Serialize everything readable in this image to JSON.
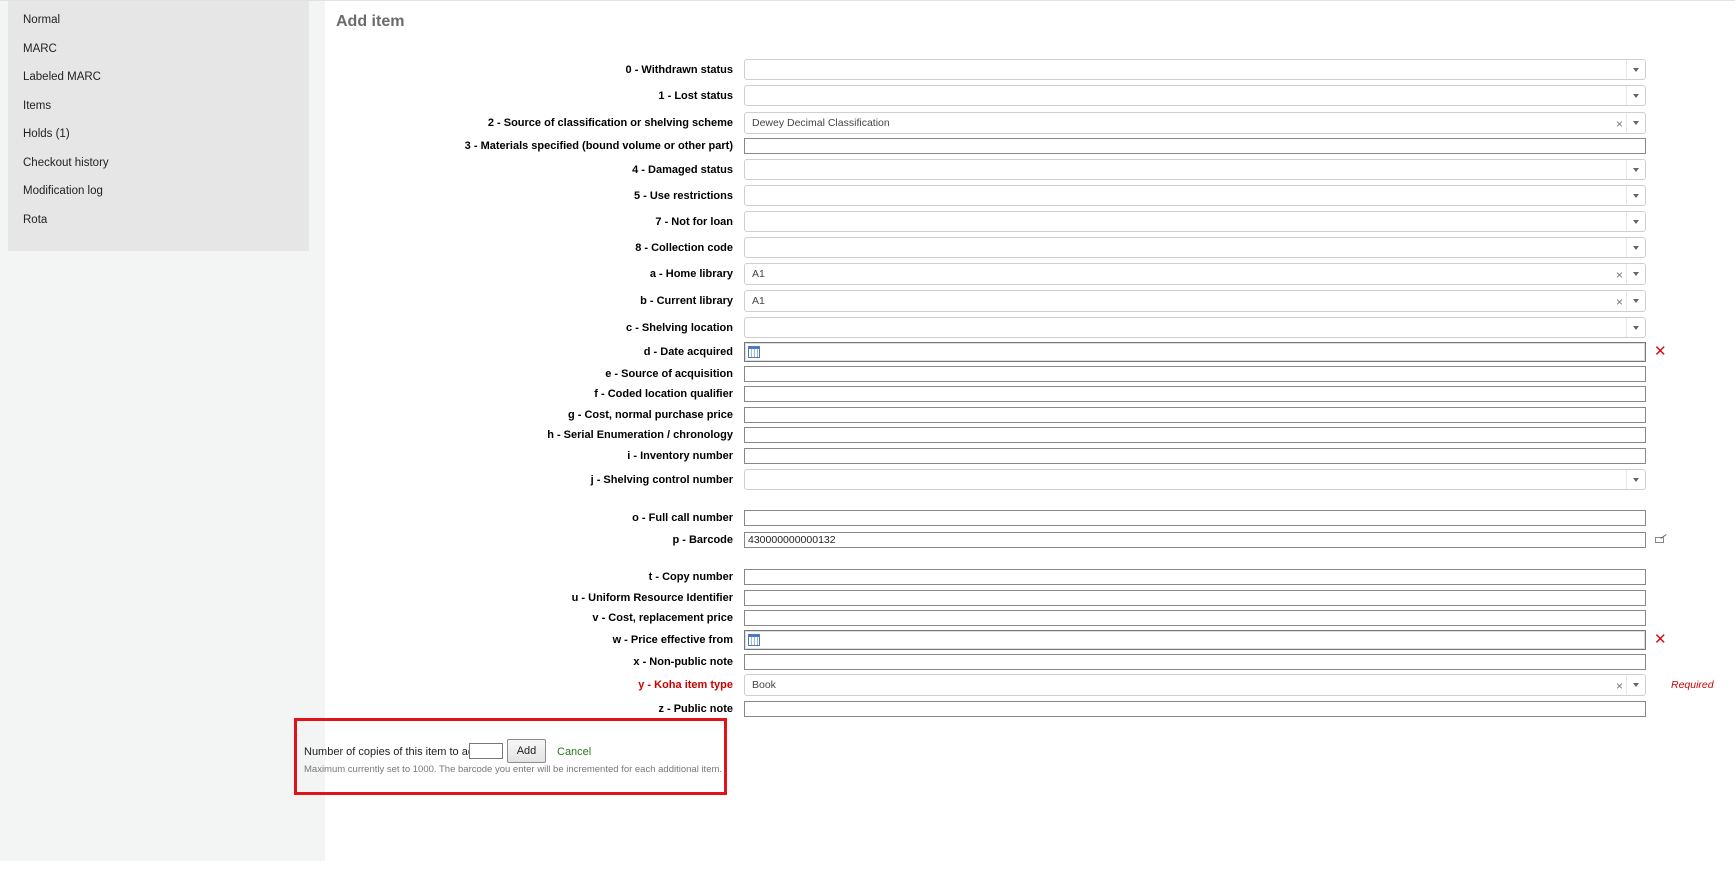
{
  "sidebar": {
    "items": [
      {
        "label": "Normal"
      },
      {
        "label": "MARC"
      },
      {
        "label": "Labeled MARC"
      },
      {
        "label": "Items"
      },
      {
        "label": "Holds (1)"
      },
      {
        "label": "Checkout history"
      },
      {
        "label": "Modification log"
      },
      {
        "label": "Rota"
      }
    ]
  },
  "main": {
    "title": "Add item",
    "fields": {
      "withdrawn_status": {
        "label": "0 - Withdrawn status",
        "value": ""
      },
      "lost_status": {
        "label": "1 - Lost status",
        "value": ""
      },
      "classification_source": {
        "label": "2 - Source of classification or shelving scheme",
        "value": "Dewey Decimal Classification"
      },
      "materials_specified": {
        "label": "3 - Materials specified (bound volume or other part)",
        "value": ""
      },
      "damaged_status": {
        "label": "4 - Damaged status",
        "value": ""
      },
      "use_restrictions": {
        "label": "5 - Use restrictions",
        "value": ""
      },
      "not_for_loan": {
        "label": "7 - Not for loan",
        "value": ""
      },
      "collection_code": {
        "label": "8 - Collection code",
        "value": ""
      },
      "home_library": {
        "label": "a - Home library",
        "value": "A1"
      },
      "current_library": {
        "label": "b - Current library",
        "value": "A1"
      },
      "shelving_location": {
        "label": "c - Shelving location",
        "value": ""
      },
      "date_acquired": {
        "label": "d - Date acquired",
        "value": ""
      },
      "source_of_acquisition": {
        "label": "e - Source of acquisition",
        "value": ""
      },
      "coded_location_qualifier": {
        "label": "f - Coded location qualifier",
        "value": ""
      },
      "cost_normal_purchase_price": {
        "label": "g - Cost, normal purchase price",
        "value": ""
      },
      "serial_enumeration": {
        "label": "h - Serial Enumeration / chronology",
        "value": ""
      },
      "inventory_number": {
        "label": "i - Inventory number",
        "value": ""
      },
      "shelving_control_number": {
        "label": "j - Shelving control number",
        "value": ""
      },
      "full_call_number": {
        "label": "o - Full call number",
        "value": ""
      },
      "barcode": {
        "label": "p - Barcode",
        "value": "430000000000132"
      },
      "copy_number": {
        "label": "t - Copy number",
        "value": ""
      },
      "uri": {
        "label": "u - Uniform Resource Identifier",
        "value": ""
      },
      "cost_replacement_price": {
        "label": "v - Cost, replacement price",
        "value": ""
      },
      "price_effective_from": {
        "label": "w - Price effective from",
        "value": ""
      },
      "non_public_note": {
        "label": "x - Non-public note",
        "value": ""
      },
      "koha_item_type": {
        "label": "y - Koha item type",
        "value": "Book",
        "required_note": "Required"
      },
      "public_note": {
        "label": "z - Public note",
        "value": ""
      }
    },
    "add_copies": {
      "label": "Number of copies of this item to add:",
      "value": "",
      "add_label": "Add",
      "cancel_label": "Cancel",
      "note": "Maximum currently set to 1000. The barcode you enter will be incremented for each additional item."
    }
  },
  "colors": {
    "required": "#cc0000",
    "highlight_border": "#e0131a",
    "cancel_link": "#2b7a1f",
    "sidebar_bg": "#e6e6e6"
  },
  "icons": [
    "calendar-icon",
    "clear-date-icon",
    "edit-barcode-icon",
    "clear-selection-icon",
    "dropdown-arrow-icon"
  ]
}
